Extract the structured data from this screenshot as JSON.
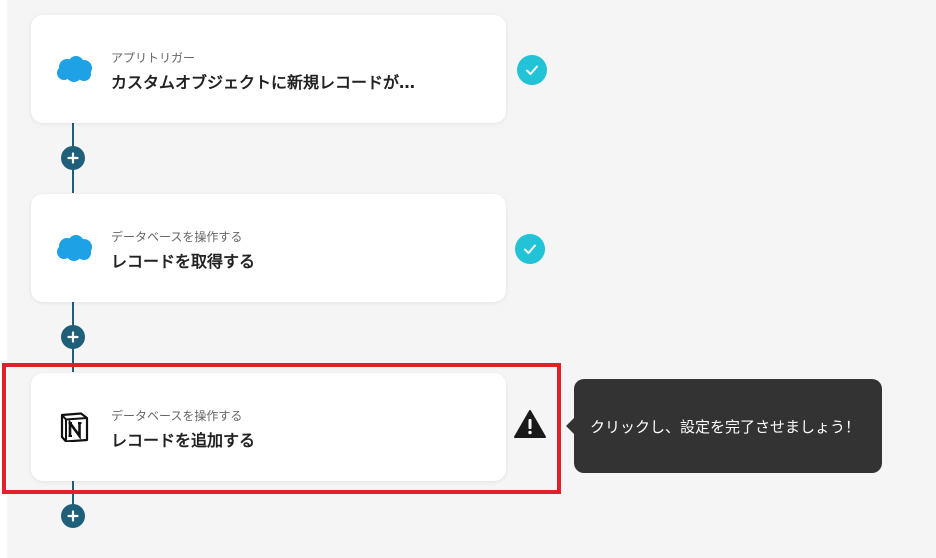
{
  "steps": [
    {
      "app_icon": "salesforce-cloud-icon",
      "subtitle": "アプリトリガー",
      "title": "カスタムオブジェクトに新規レコードが…",
      "status": "completed"
    },
    {
      "app_icon": "salesforce-cloud-icon",
      "subtitle": "データベースを操作する",
      "title": "レコードを取得する",
      "status": "completed"
    },
    {
      "app_icon": "notion-icon",
      "subtitle": "データベースを操作する",
      "title": "レコードを追加する",
      "status": "warning"
    }
  ],
  "tooltip": {
    "text": "クリックし、設定を完了させましょう！"
  },
  "colors": {
    "background": "#f5f5f5",
    "connector": "#1f5f7a",
    "check_badge": "#22c3d6",
    "salesforce": "#1ea1e5",
    "highlight_border": "#e0202a",
    "tooltip_bg": "#333333"
  }
}
